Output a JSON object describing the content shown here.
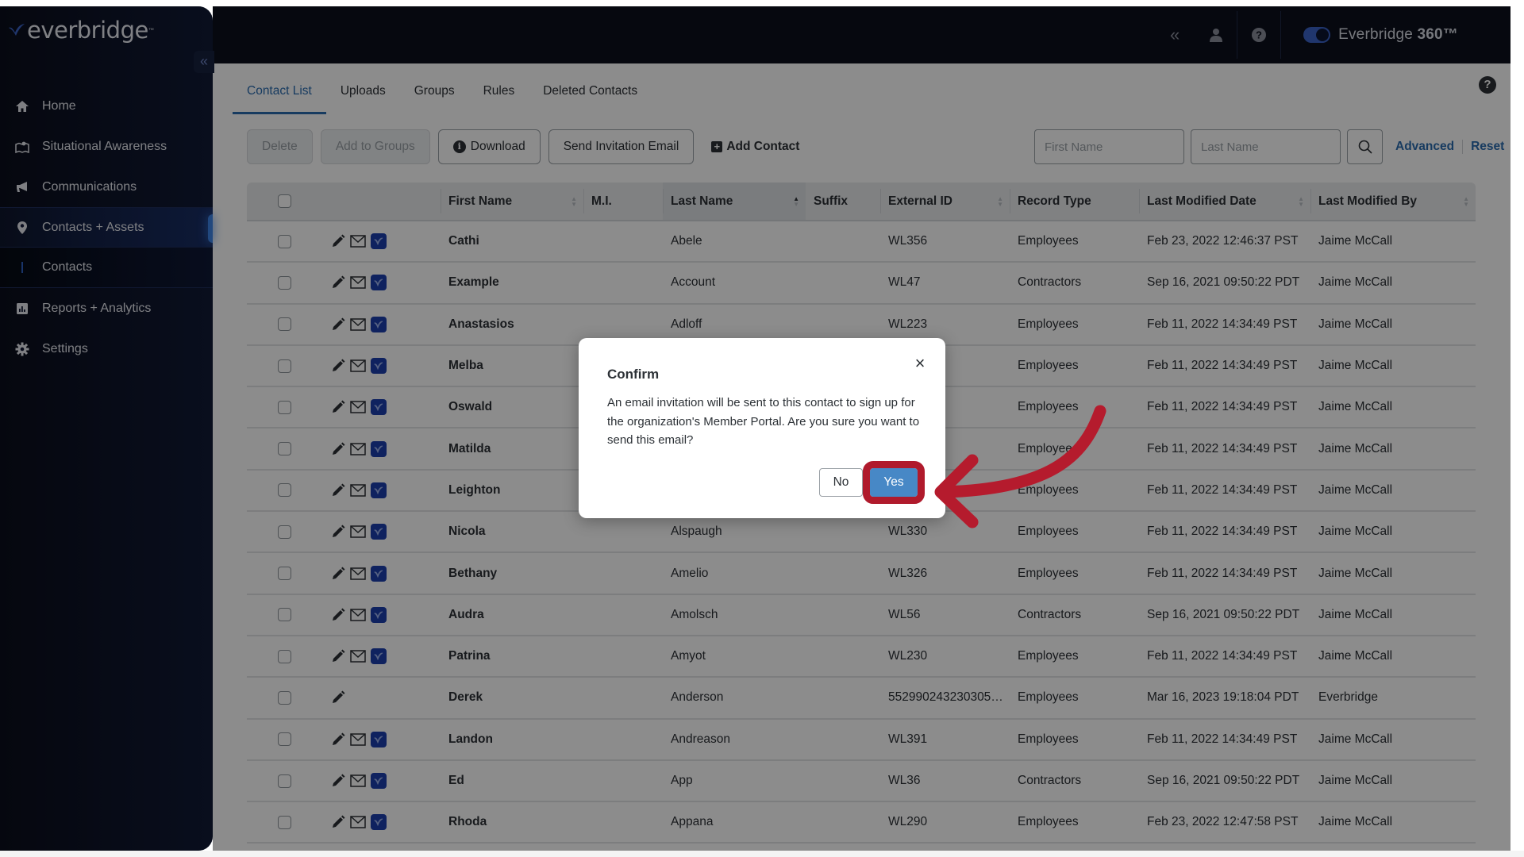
{
  "sidebar": {
    "logo_text": "everbridge",
    "logo_tm": "™",
    "collapse_icon": "«",
    "items": [
      {
        "label": "Home",
        "icon": "home-icon"
      },
      {
        "label": "Situational Awareness",
        "icon": "map-icon"
      },
      {
        "label": "Communications",
        "icon": "megaphone-icon"
      },
      {
        "label": "Contacts + Assets",
        "icon": "location-pin-icon",
        "active": true
      },
      {
        "label": "Contacts",
        "sub": true
      },
      {
        "label": "Reports + Analytics",
        "icon": "chart-icon"
      },
      {
        "label": "Settings",
        "icon": "gear-icon"
      }
    ]
  },
  "header": {
    "collapse_icon": "«",
    "brand": "Everbridge",
    "brand_bold": "360™",
    "toggle_on": true
  },
  "tabs": [
    {
      "label": "Contact List",
      "active": true
    },
    {
      "label": "Uploads"
    },
    {
      "label": "Groups"
    },
    {
      "label": "Rules"
    },
    {
      "label": "Deleted Contacts"
    }
  ],
  "toolbar": {
    "delete": "Delete",
    "add_to_groups": "Add to Groups",
    "download": "Download",
    "send_invitation": "Send Invitation Email",
    "add_contact": "Add Contact"
  },
  "search": {
    "first_name_placeholder": "First Name",
    "last_name_placeholder": "Last Name",
    "advanced": "Advanced",
    "reset": "Reset"
  },
  "table": {
    "columns": [
      "First Name",
      "M.I.",
      "Last Name",
      "Suffix",
      "External ID",
      "Record Type",
      "Last Modified Date",
      "Last Modified By"
    ],
    "rows": [
      {
        "first": "Cathi",
        "mi": "",
        "last": "Abele",
        "suffix": "",
        "ext": "WL356",
        "type": "Employees",
        "date": "Feb 23, 2022 12:46:37 PST",
        "by": "Jaime McCall",
        "mail": true
      },
      {
        "first": "Example",
        "mi": "",
        "last": "Account",
        "suffix": "",
        "ext": "WL47",
        "type": "Contractors",
        "date": "Sep 16, 2021 09:50:22 PDT",
        "by": "Jaime McCall",
        "mail": true
      },
      {
        "first": "Anastasios",
        "mi": "",
        "last": "Adloff",
        "suffix": "",
        "ext": "WL223",
        "type": "Employees",
        "date": "Feb 11, 2022 14:34:49 PST",
        "by": "Jaime McCall",
        "mail": true
      },
      {
        "first": "Melba",
        "mi": "",
        "last": "",
        "suffix": "",
        "ext": "",
        "type": "Employees",
        "date": "Feb 11, 2022 14:34:49 PST",
        "by": "Jaime McCall",
        "mail": true
      },
      {
        "first": "Oswald",
        "mi": "",
        "last": "",
        "suffix": "",
        "ext": "",
        "type": "Employees",
        "date": "Feb 11, 2022 14:34:49 PST",
        "by": "Jaime McCall",
        "mail": true
      },
      {
        "first": "Matilda",
        "mi": "",
        "last": "",
        "suffix": "",
        "ext": "",
        "type": "Employees",
        "date": "Feb 11, 2022 14:34:49 PST",
        "by": "Jaime McCall",
        "mail": true
      },
      {
        "first": "Leighton",
        "mi": "",
        "last": "",
        "suffix": "",
        "ext": "",
        "type": "Employees",
        "date": "Feb 11, 2022 14:34:49 PST",
        "by": "Jaime McCall",
        "mail": true
      },
      {
        "first": "Nicola",
        "mi": "",
        "last": "Alspaugh",
        "suffix": "",
        "ext": "WL330",
        "type": "Employees",
        "date": "Feb 11, 2022 14:34:49 PST",
        "by": "Jaime McCall",
        "mail": true
      },
      {
        "first": "Bethany",
        "mi": "",
        "last": "Amelio",
        "suffix": "",
        "ext": "WL326",
        "type": "Employees",
        "date": "Feb 11, 2022 14:34:49 PST",
        "by": "Jaime McCall",
        "mail": true
      },
      {
        "first": "Audra",
        "mi": "",
        "last": "Amolsch",
        "suffix": "",
        "ext": "WL56",
        "type": "Contractors",
        "date": "Sep 16, 2021 09:50:22 PDT",
        "by": "Jaime McCall",
        "mail": true
      },
      {
        "first": "Patrina",
        "mi": "",
        "last": "Amyot",
        "suffix": "",
        "ext": "WL230",
        "type": "Employees",
        "date": "Feb 11, 2022 14:34:49 PST",
        "by": "Jaime McCall",
        "mail": true
      },
      {
        "first": "Derek",
        "mi": "",
        "last": "Anderson",
        "suffix": "",
        "ext": "552990243230305…",
        "type": "Employees",
        "date": "Mar 16, 2023 19:18:04 PDT",
        "by": "Everbridge",
        "mail": false
      },
      {
        "first": "Landon",
        "mi": "",
        "last": "Andreason",
        "suffix": "",
        "ext": "WL391",
        "type": "Employees",
        "date": "Feb 11, 2022 14:34:49 PST",
        "by": "Jaime McCall",
        "mail": true
      },
      {
        "first": "Ed",
        "mi": "",
        "last": "App",
        "suffix": "",
        "ext": "WL36",
        "type": "Contractors",
        "date": "Sep 16, 2021 09:50:22 PDT",
        "by": "Jaime McCall",
        "mail": true
      },
      {
        "first": "Rhoda",
        "mi": "",
        "last": "Appana",
        "suffix": "",
        "ext": "WL290",
        "type": "Employees",
        "date": "Feb 23, 2022 12:47:58 PST",
        "by": "Jaime McCall",
        "mail": true
      }
    ]
  },
  "modal": {
    "title": "Confirm",
    "body": "An email invitation will be sent to this contact to sign up for the organization's Member Portal. Are you sure you want to send this email?",
    "no": "No",
    "yes": "Yes",
    "close_icon": "×"
  },
  "annotation": {
    "color": "#b51b2d",
    "target": "yes-button"
  }
}
